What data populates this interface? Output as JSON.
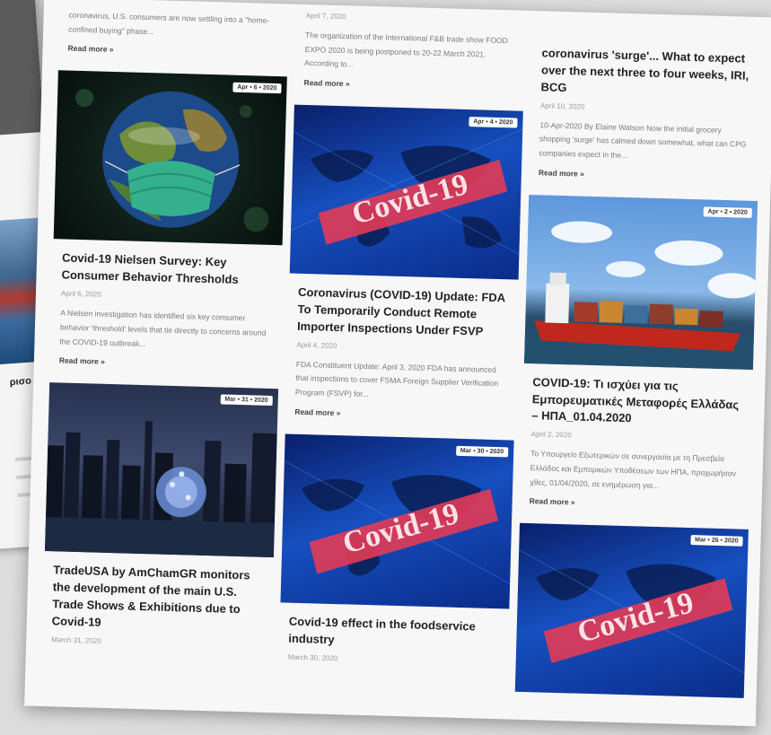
{
  "back_page": {
    "title_fragment": "ρισο"
  },
  "col1": {
    "top_excerpt": "coronavirus, U.S. consumers are now settling into a \"home-confined buying\" phase...",
    "top_read_more": "Read more »",
    "posts": [
      {
        "badge": "Apr • 6 • 2020",
        "title": "Covid-19 Nielsen Survey: Key Consumer Behavior Thresholds",
        "date": "April 6, 2020",
        "excerpt": "A Nielsen investigation has identified six key consumer behavior 'threshold' levels that tie directly to concerns around the COVID-19 outbreak...",
        "read_more": "Read more »"
      },
      {
        "badge": "Mar • 31 • 2020",
        "title": "TradeUSA by AmChamGR monitors the development of the main U.S. Trade Shows & Exhibitions due to Covid-19",
        "date": "March 31, 2020"
      }
    ]
  },
  "col2": {
    "top_date": "April 7, 2020",
    "top_excerpt": "The organization of the International F&B trade show FOOD EXPO 2020 is being postponed to 20-22 March 2021. According to...",
    "top_read_more": "Read more »",
    "posts": [
      {
        "badge": "Apr • 4 • 2020",
        "title": "Coronavirus (COVID-19) Update: FDA To Temporarily Conduct Remote Importer Inspections Under FSVP",
        "date": "April 4, 2020",
        "excerpt": "FDA Constituent Update: April 3, 2020 FDA has announced that inspections to cover FSMA Foreign Supplier Verification Program (FSVP) for...",
        "read_more": "Read more »",
        "image_text": "Covid-19"
      },
      {
        "badge": "Mar • 30 • 2020",
        "title": "Covid-19 effect in the foodservice industry",
        "date": "March 30, 2020",
        "image_text": "Covid-19"
      }
    ]
  },
  "col3": {
    "top_title": "coronavirus 'surge'... What to expect over the next three to four weeks, IRI, BCG",
    "top_date": "April 10, 2020",
    "top_excerpt": "10-Apr-2020 By Elaine Watson Now the initial grocery shopping 'surge' has calmed down somewhat, what can CPG companies expect in the...",
    "top_read_more": "Read more »",
    "posts": [
      {
        "badge": "Apr • 2 • 2020",
        "title": "COVID-19: Τι ισχύει για τις Εμπορευματικές Μεταφορές Ελλάδας – ΗΠΑ_01.04.2020",
        "date": "April 2, 2020",
        "excerpt": "Το Υπουργείο Εξωτερικών σε συνεργασία με τη Πρεσβεία Ελλάδος και Εμπορικών Υποθέσεων των ΗΠΑ, προχωρήσαν χθες, 01/04/2020, σε ενημέρωση για...",
        "read_more": "Read more »"
      },
      {
        "badge": "Mar • 26 • 2020",
        "image_text": "Covid-19"
      }
    ]
  },
  "colors": {
    "page_bg": "#f7f7f7",
    "title": "#222222",
    "muted": "#9a9a9a",
    "covid_banner": "#e23b57",
    "mask": "#34b08c"
  },
  "icons": {
    "read_more_arrow": "chevron-double-right"
  }
}
